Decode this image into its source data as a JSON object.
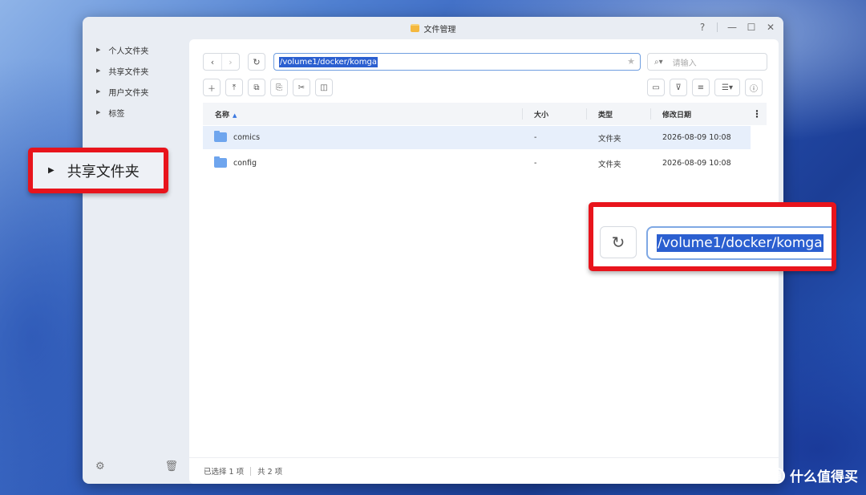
{
  "window": {
    "title": "文件管理",
    "controls": {
      "help": "?",
      "minimize": "—",
      "maximize": "☐",
      "close": "✕"
    }
  },
  "sidebar": {
    "items": [
      {
        "label": "个人文件夹"
      },
      {
        "label": "共享文件夹"
      },
      {
        "label": "用户文件夹"
      },
      {
        "label": "标签"
      }
    ]
  },
  "toolbar": {
    "back": "‹",
    "forward": "›",
    "refresh": "↻",
    "path": "/volume1/docker/komga",
    "search_placeholder": "请输入"
  },
  "table": {
    "headers": {
      "name": "名称",
      "size": "大小",
      "type": "类型",
      "modified": "修改日期"
    },
    "rows": [
      {
        "name": "comics",
        "size": "-",
        "type": "文件夹",
        "date": "2026-08-09 10:08"
      },
      {
        "name": "config",
        "size": "-",
        "type": "文件夹",
        "date": "2026-08-09 10:08"
      }
    ]
  },
  "status": {
    "selected": "已选择 1 项",
    "total": "共 2 项"
  },
  "callouts": {
    "left_label": "共享文件夹",
    "right_path": "/volume1/docker/komga"
  },
  "watermark": {
    "text": "什么值得买",
    "icon": "值"
  },
  "colors": {
    "highlight_border": "#e8141c",
    "selection": "#2b5fd0",
    "folder": "#6ea5ee"
  }
}
